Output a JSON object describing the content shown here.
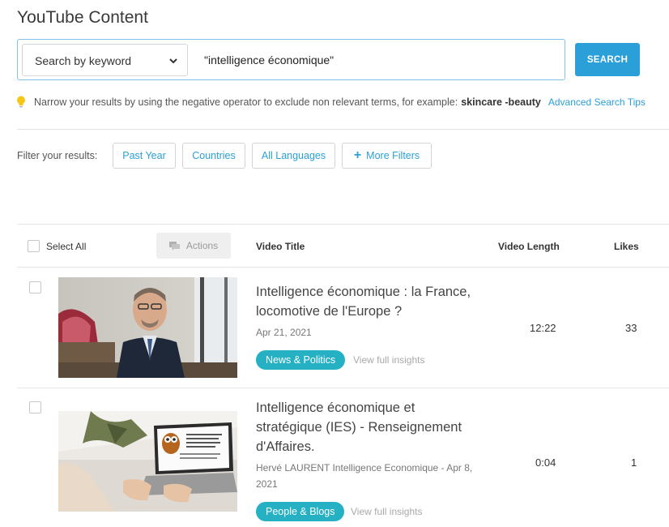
{
  "header": {
    "title": "YouTube Content"
  },
  "search": {
    "mode_label": "Search by keyword",
    "query": "\"intelligence économique\"",
    "button_label": "SEARCH"
  },
  "tip": {
    "text": "Narrow your results by using the negative operator to exclude non relevant terms, for example:",
    "example": "skincare -beauty",
    "link": "Advanced Search Tips"
  },
  "filters": {
    "label": "Filter your results:",
    "buttons": [
      "Past Year",
      "Countries",
      "All Languages",
      "More Filters"
    ]
  },
  "table": {
    "select_all": "Select All",
    "actions": "Actions",
    "columns": {
      "title": "Video Title",
      "length": "Video Length",
      "likes": "Likes"
    },
    "rows": [
      {
        "title": "Intelligence économique : la France, locomotive de l'Europe ?",
        "meta": "Apr 21, 2021",
        "category": "News & Politics",
        "insights": "View full insights",
        "length": "12:22",
        "likes": "33"
      },
      {
        "title": "Intelligence économique et stratégique (IES) - Renseignement d'Affaires.",
        "meta": "Hervé LAURENT Intelligence Economique - Apr 8, 2021",
        "category": "People & Blogs",
        "insights": "View full insights",
        "length": "0:04",
        "likes": "1",
        "thumb_caption": "Intelligence économique et stratégique (IES) - Renseignement d'Affaires."
      }
    ]
  },
  "colors": {
    "accent": "#2a9fd8",
    "badge": "#25b0c4",
    "tip_bulb": "#f5c518"
  }
}
